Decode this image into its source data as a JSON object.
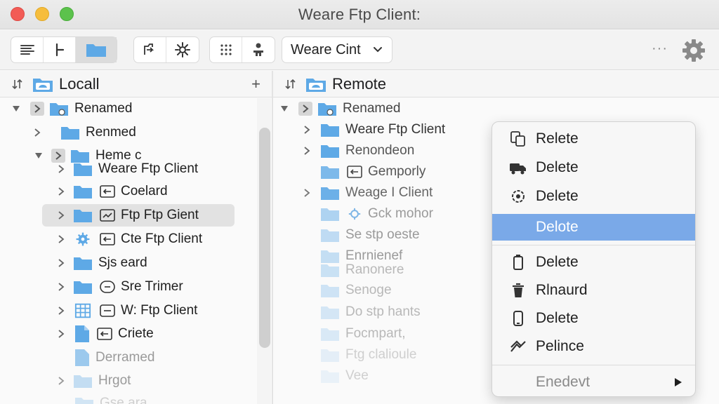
{
  "window": {
    "title": "Weare Ftp Client:"
  },
  "toolbar": {
    "server_label": "Weare Cint",
    "more_label": "···"
  },
  "local": {
    "header": "Locall",
    "add_label": "+",
    "items": [
      {
        "label": "Renamed"
      },
      {
        "label": "Renmed"
      },
      {
        "label": "Heme c"
      },
      {
        "label": "Weare Ftp Client"
      },
      {
        "label": "Coelard"
      },
      {
        "label": "Ftp Ftp Gient"
      },
      {
        "label": "Cte Ftp Client"
      },
      {
        "label": "Sjs eard"
      },
      {
        "label": "Sre Trimer"
      },
      {
        "label": "W: Ftp Client"
      },
      {
        "label": "Criete"
      },
      {
        "label": "Derramed"
      },
      {
        "label": "Hrgot"
      },
      {
        "label": "Gse ara"
      }
    ]
  },
  "remote": {
    "header": "Remote",
    "items": [
      {
        "label": "Renamed"
      },
      {
        "label": "Weare Ftp Client"
      },
      {
        "label": "Renondeon"
      },
      {
        "label": "Gemporly"
      },
      {
        "label": "Weage I Client"
      },
      {
        "label": "Gck mohor"
      },
      {
        "label": "Se stp oeste"
      },
      {
        "label": "Enrnienef"
      },
      {
        "label": "Ranonere"
      },
      {
        "label": "Senoge"
      },
      {
        "label": "Do stp hants"
      },
      {
        "label": "Focmpart,"
      },
      {
        "label": "Ftg clalioule"
      },
      {
        "label": "Vee"
      }
    ]
  },
  "context_menu": {
    "items": [
      {
        "label": "Relete",
        "icon": "copy-icon"
      },
      {
        "label": "Delete",
        "icon": "truck-icon"
      },
      {
        "label": "Delete",
        "icon": "cog-icon"
      },
      {
        "label": "Delote",
        "icon": "",
        "highlighted": true
      },
      {
        "label": "Delete",
        "icon": "trash-can-icon"
      },
      {
        "label": "Rlnaurd",
        "icon": "trash-icon"
      },
      {
        "label": "Delete",
        "icon": "phone-icon"
      },
      {
        "label": "Pelince",
        "icon": "share-icon"
      },
      {
        "label": "Enedevt",
        "icon": "",
        "disabled": true,
        "submenu": true
      }
    ]
  },
  "colors": {
    "folder": "#5ea9e6",
    "highlight": "#7aa9e8",
    "close": "#f25c56",
    "minimize": "#f6bd3c",
    "zoom": "#5cc24c"
  }
}
